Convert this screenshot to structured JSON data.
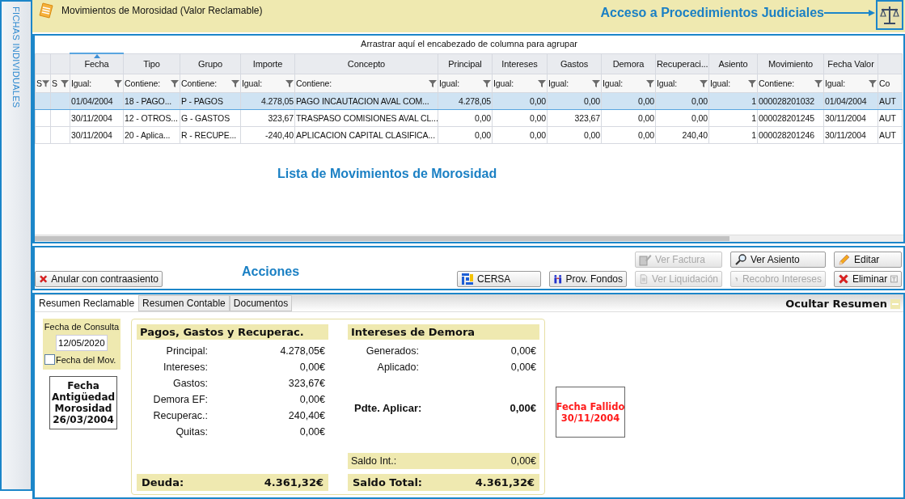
{
  "sidebar": {
    "label": "FICHAS INDIVIDUALES"
  },
  "header": {
    "title": "Movimientos de Morosidad (Valor Reclamable)",
    "annotation": "Acceso a Procedimientos Judiciales"
  },
  "grid": {
    "group_hint": "Arrastrar aquí el encabezado de columna para agrupar",
    "annotation": "Lista de Movimientos de Morosidad",
    "flag_columns": [
      {
        "filter": "S"
      },
      {
        "filter": "S"
      }
    ],
    "columns": [
      {
        "label": "Fecha",
        "filter": "Igual:",
        "sorted": true,
        "kind": "text"
      },
      {
        "label": "Tipo",
        "filter": "Contiene:",
        "sorted": false,
        "kind": "text"
      },
      {
        "label": "Grupo",
        "filter": "Contiene:",
        "sorted": false,
        "kind": "text"
      },
      {
        "label": "Importe",
        "filter": "Igual:",
        "sorted": false,
        "kind": "number"
      },
      {
        "label": "Concepto",
        "filter": "Contiene:",
        "sorted": false,
        "kind": "text"
      },
      {
        "label": "Principal",
        "filter": "Igual:",
        "sorted": false,
        "kind": "number"
      },
      {
        "label": "Intereses",
        "filter": "Igual:",
        "sorted": false,
        "kind": "number"
      },
      {
        "label": "Gastos",
        "filter": "Igual:",
        "sorted": false,
        "kind": "number"
      },
      {
        "label": "Demora",
        "filter": "Igual:",
        "sorted": false,
        "kind": "number"
      },
      {
        "label": "Recuperaci...",
        "filter": "Igual:",
        "sorted": false,
        "kind": "number"
      },
      {
        "label": "Asiento",
        "filter": "Igual:",
        "sorted": false,
        "kind": "number"
      },
      {
        "label": "Movimiento",
        "filter": "Contiene:",
        "sorted": false,
        "kind": "text"
      },
      {
        "label": "Fecha Valor",
        "filter": "Igual:",
        "sorted": false,
        "kind": "text"
      },
      {
        "filter": "Co",
        "sorted": false,
        "kind": "text"
      }
    ],
    "rows": [
      {
        "selected": true,
        "cells": [
          "01/04/2004",
          "18 - PAGO...",
          "P - PAGOS",
          "4.278,05",
          "PAGO INCAUTACION AVAL COM...",
          "4.278,05",
          "0,00",
          "0,00",
          "0,00",
          "0,00",
          "1",
          "000028201032",
          "01/04/2004",
          "AUT"
        ]
      },
      {
        "selected": false,
        "cells": [
          "30/11/2004",
          "12 - OTROS...",
          "G - GASTOS",
          "323,67",
          "TRASPASO COMISIONES AVAL CL...",
          "0,00",
          "0,00",
          "323,67",
          "0,00",
          "0,00",
          "1",
          "000028201245",
          "30/11/2004",
          "AUT"
        ]
      },
      {
        "selected": false,
        "cells": [
          "30/11/2004",
          "20 - Aplica...",
          "R - RECUPE...",
          "-240,40",
          "APLICACION CAPITAL CLASIFICA...",
          "0,00",
          "0,00",
          "0,00",
          "0,00",
          "240,40",
          "1",
          "000028201246",
          "30/11/2004",
          "AUT"
        ]
      }
    ]
  },
  "actions": {
    "annotation": "Acciones",
    "buttons": [
      {
        "label": "Ver Factura",
        "kind": "invoice",
        "disabled": true,
        "tagged": false
      },
      {
        "label": "Ver Asiento",
        "kind": "entry",
        "disabled": false,
        "tagged": false
      },
      {
        "label": "Editar",
        "kind": "edit",
        "disabled": false,
        "tagged": false
      },
      {
        "label": "Anular con contraasiento",
        "kind": "void",
        "disabled": false,
        "tagged": false
      },
      {
        "label": "CERSA",
        "kind": "cersa",
        "disabled": false,
        "tagged": false
      },
      {
        "label": "Prov. Fondos",
        "kind": "funds",
        "disabled": false,
        "tagged": false
      },
      {
        "label": "Ver Liquidación",
        "kind": "settlement",
        "disabled": true,
        "tagged": false
      },
      {
        "label": "Recobro Intereses",
        "kind": "recovery",
        "disabled": true,
        "tagged": false
      },
      {
        "label": "Eliminar",
        "kind": "delete",
        "disabled": false,
        "tagged": true
      }
    ]
  },
  "summary": {
    "tabs": [
      {
        "label": "Resumen Reclamable",
        "selected": true
      },
      {
        "label": "Resumen Contable",
        "selected": false
      },
      {
        "label": "Documentos",
        "selected": false
      }
    ],
    "hide_label": "Ocultar Resumen",
    "consult": {
      "label": "Fecha de Consulta",
      "value": "12/05/2020",
      "checkbox": {
        "label": "Fecha del Mov.",
        "checked": false
      }
    },
    "age_box": {
      "label": "Fecha Antigüedad Morosidad",
      "value": "26/03/2004"
    },
    "sections": [
      {
        "title": "Pagos, Gastos y Recuperac.",
        "rows": [
          {
            "kind": "plain",
            "label": "Principal:",
            "value": "4.278,05€"
          },
          {
            "kind": "plain",
            "label": "Intereses:",
            "value": "0,00€"
          },
          {
            "kind": "plain",
            "label": "Gastos:",
            "value": "323,67€"
          },
          {
            "kind": "plain",
            "label": "Demora EF:",
            "value": "0,00€"
          },
          {
            "kind": "plain",
            "label": "Recuperac.:",
            "value": "240,40€"
          },
          {
            "kind": "plain",
            "label": "Quitas:",
            "value": "0,00€"
          }
        ],
        "total": {
          "label": "Deuda:",
          "value": "4.361,32€"
        }
      },
      {
        "title": "Intereses de Demora",
        "rows": [
          {
            "kind": "plain",
            "label": "Generados:",
            "value": "0,00€"
          },
          {
            "kind": "plain",
            "label": "Aplicado:",
            "value": "0,00€"
          },
          {
            "kind": "emphasis",
            "label": "Pdte. Aplicar:",
            "value": "0,00€"
          },
          {
            "kind": "highlight",
            "label": "Saldo Int.:",
            "value": "0,00€"
          }
        ],
        "total": {
          "label": "Saldo Total:",
          "value": "4.361,32€"
        }
      }
    ],
    "failed_box": {
      "label": "Fecha Fallido",
      "value": "30/11/2004"
    }
  }
}
